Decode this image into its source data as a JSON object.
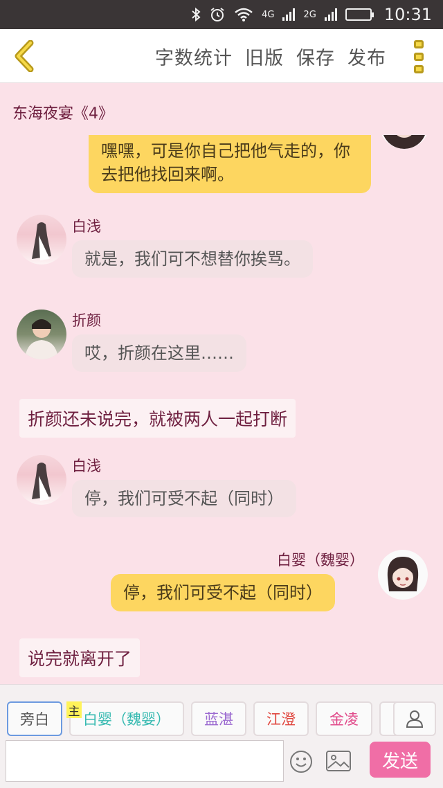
{
  "status_bar": {
    "network_1": "4G",
    "network_2": "2G",
    "time": "10:31"
  },
  "toolbar": {
    "word_count": "字数统计",
    "old_version": "旧版",
    "save": "保存",
    "publish": "发布"
  },
  "chapter_title": "东海夜宴《4》",
  "messages": [
    {
      "type": "right",
      "text": "嘿嘿，可是你自己把他气走的，你去把他找回来啊。"
    },
    {
      "type": "left",
      "name": "白浅",
      "avatar": "white-robed-woman-avatar",
      "text": "就是，我们可不想替你挨骂。"
    },
    {
      "type": "left",
      "name": "折颜",
      "avatar": "man-in-robe-avatar",
      "text": "哎，折颜在这里……"
    },
    {
      "type": "narration",
      "text": "折颜还未说完，就被两人一起打断"
    },
    {
      "type": "left",
      "name": "白浅",
      "avatar": "white-robed-woman-avatar",
      "text": "停，我们可受不起（同时）"
    },
    {
      "type": "right",
      "name": "白婴（魏婴）",
      "avatar": "anime-character-avatar",
      "text": "停，我们可受不起（同时）"
    },
    {
      "type": "narration",
      "text": "说完就离开了"
    }
  ],
  "bottom": {
    "main_badge": "主",
    "roles": [
      {
        "label": "旁白",
        "color": "#555555"
      },
      {
        "label": "白婴（魏婴）",
        "color": "#35b9b0"
      },
      {
        "label": "蓝湛",
        "color": "#9b6ad0"
      },
      {
        "label": "江澄",
        "color": "#e0473f"
      },
      {
        "label": "金凌",
        "color": "#e14a8a"
      }
    ],
    "input_value": "",
    "send": "发送"
  },
  "colors": {
    "background": "#fbe1e8",
    "right_bubble": "#fdd660",
    "left_bubble": "#f3e1e4",
    "send_button": "#f06ea6",
    "name_text": "#6e1f3f"
  }
}
